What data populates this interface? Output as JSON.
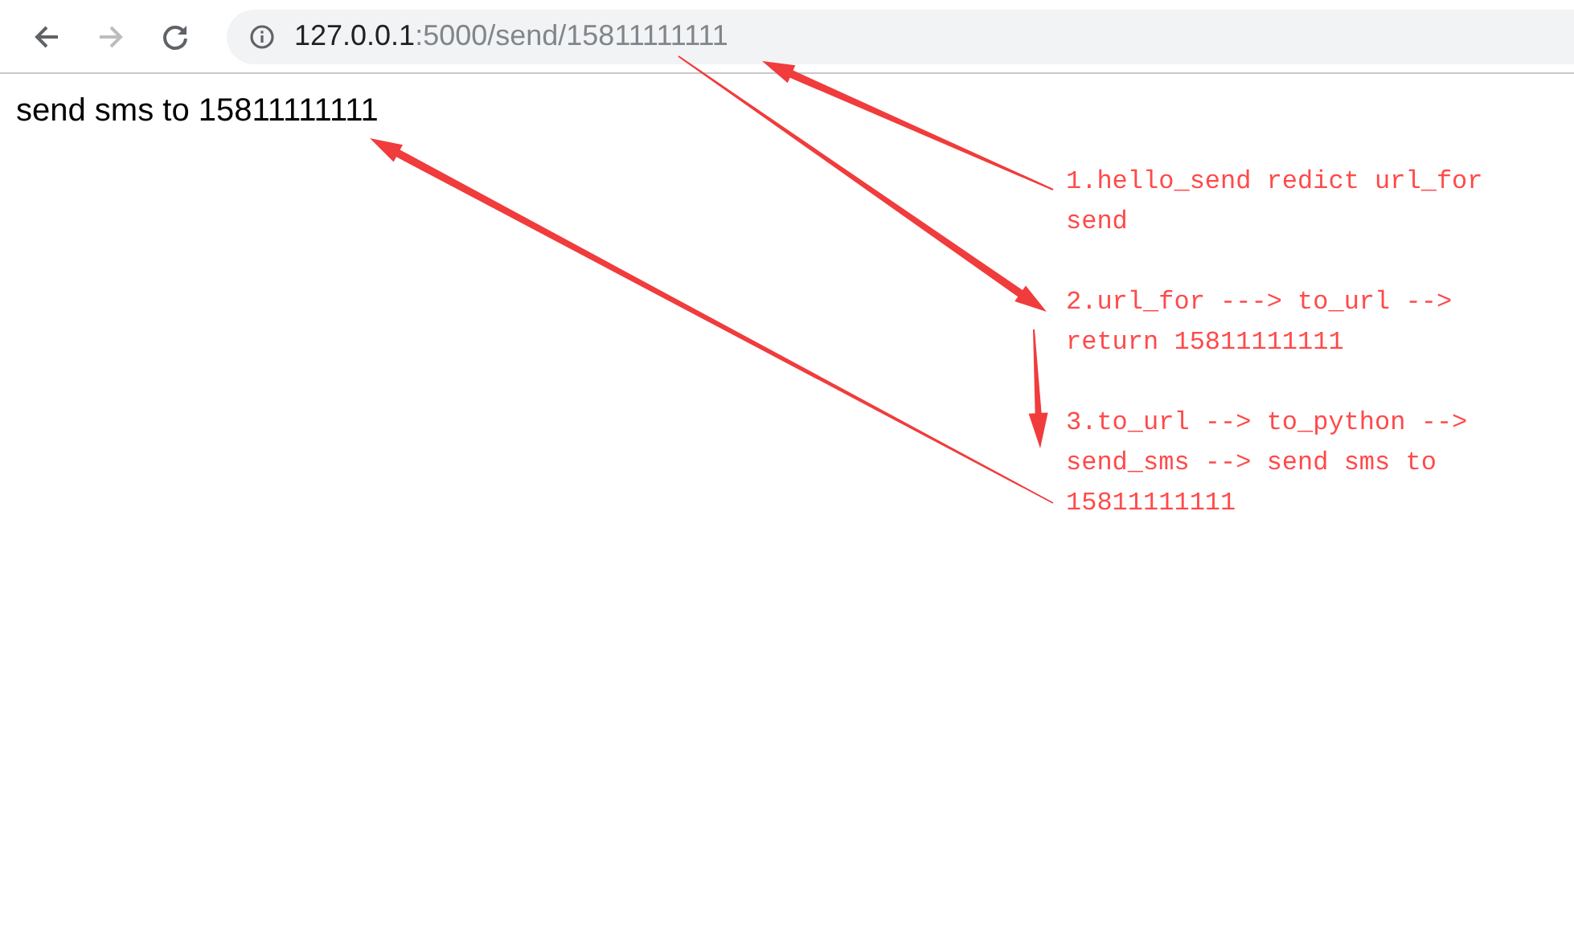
{
  "toolbar": {
    "buttons": [
      {
        "kind": "back",
        "disabled": false
      },
      {
        "kind": "forward",
        "disabled": true
      },
      {
        "kind": "reload",
        "disabled": false
      }
    ],
    "address": {
      "host": "127.0.0.1",
      "path": ":5000/send/15811111111"
    }
  },
  "page": {
    "text": "send sms to 15811111111"
  },
  "annotations": {
    "notes": [
      "1.hello_send redict url_for send",
      "2.url_for ---> to_url --> return 15811111111",
      "3.to_url --> to_python --> send_sms --> send sms to 15811111111"
    ]
  }
}
